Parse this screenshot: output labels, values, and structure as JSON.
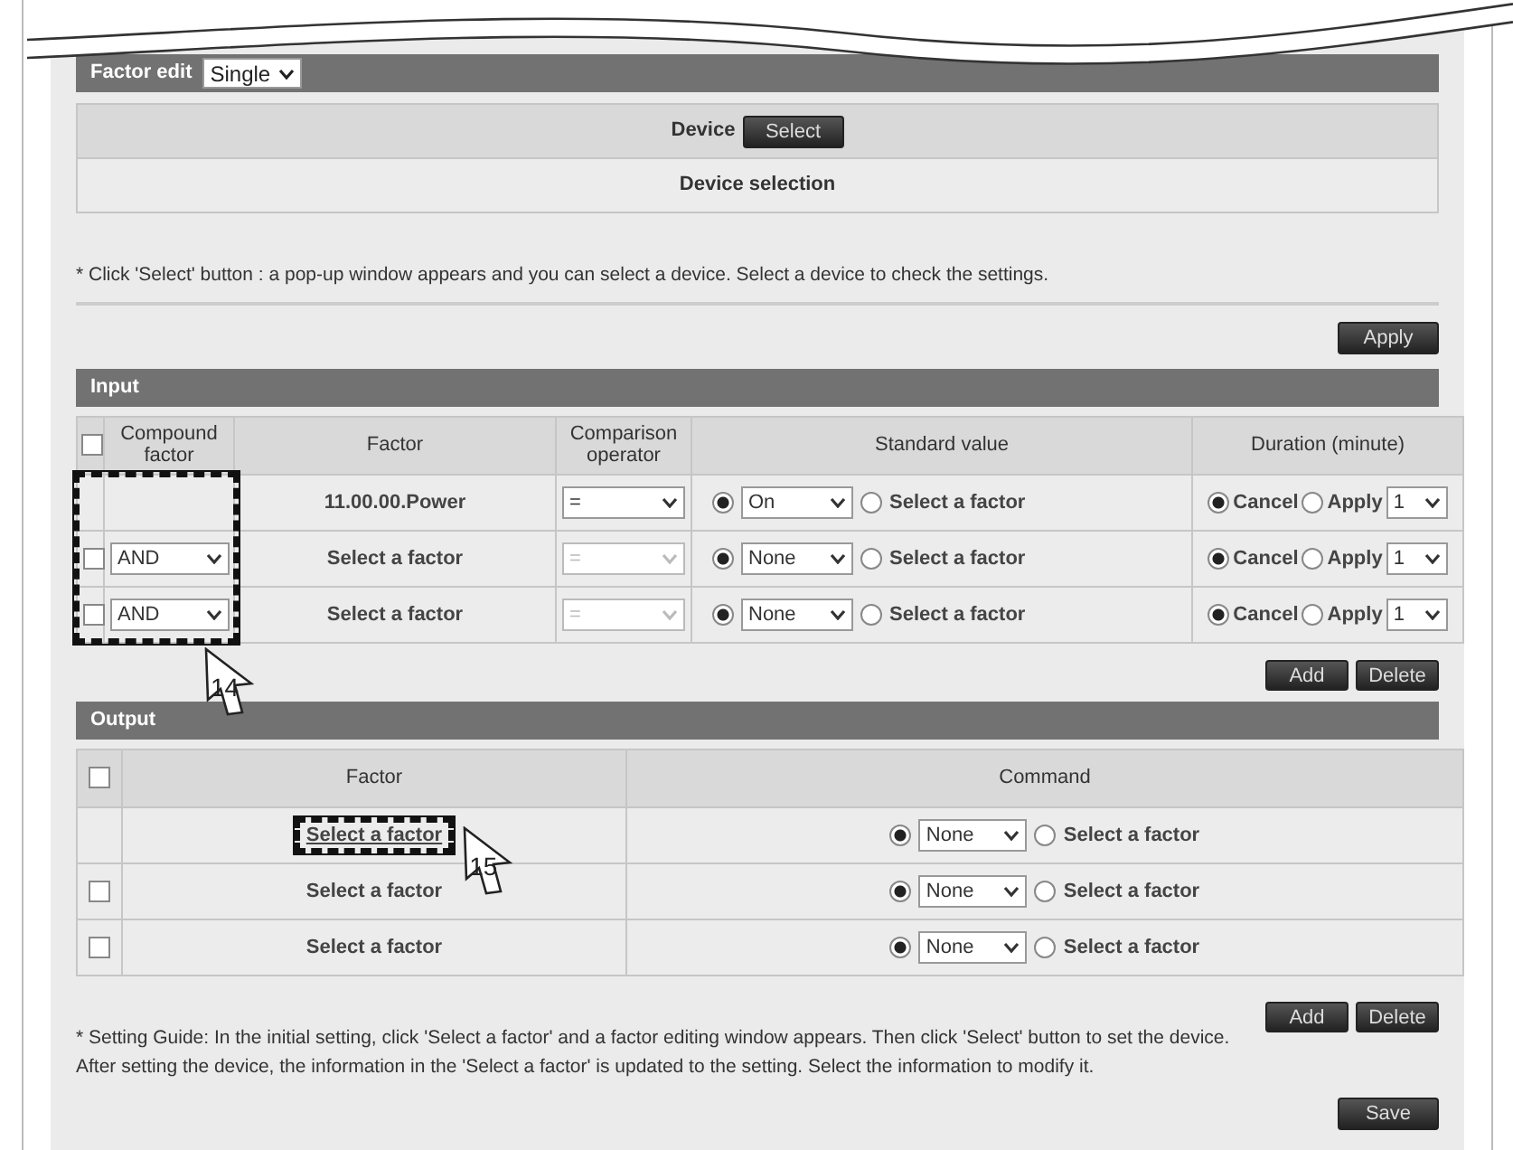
{
  "factor_edit": {
    "label": "Factor edit",
    "mode": "Single"
  },
  "device": {
    "label": "Device",
    "button": "Select",
    "selection": "Device selection"
  },
  "device_note": "* Click 'Select' button : a pop-up window appears and you can select a device. Select a device to check the settings.",
  "apply_button": "Apply",
  "input": {
    "title": "Input",
    "header_checked": false,
    "columns": [
      "Compound factor",
      "Factor",
      "Comparison operator",
      "Standard value",
      "Duration (minute)"
    ],
    "rows": [
      {
        "factor": "11.00.00.Power",
        "operator": "=",
        "operator_disabled": false,
        "list_selected": true,
        "value": "On",
        "factor_option": "Select a factor",
        "cancel_selected": true,
        "cancel_label": "Cancel",
        "apply_label": "Apply",
        "minutes": "1"
      },
      {
        "checked": false,
        "compound": "AND",
        "factor": "Select a factor",
        "operator": "=",
        "operator_disabled": true,
        "list_selected": true,
        "value": "None",
        "factor_option": "Select a factor",
        "cancel_selected": true,
        "cancel_label": "Cancel",
        "apply_label": "Apply",
        "minutes": "1"
      },
      {
        "checked": false,
        "compound": "AND",
        "factor": "Select a factor",
        "operator": "=",
        "operator_disabled": true,
        "list_selected": true,
        "value": "None",
        "factor_option": "Select a factor",
        "cancel_selected": true,
        "cancel_label": "Cancel",
        "apply_label": "Apply",
        "minutes": "1"
      }
    ],
    "callout": "14",
    "buttons": [
      "Add",
      "Delete"
    ]
  },
  "output": {
    "title": "Output",
    "header_checked": false,
    "columns": [
      "Factor",
      "Command"
    ],
    "rows": [
      {
        "factor": "Select a factor",
        "link": true,
        "list_selected": true,
        "command": "None",
        "factor_option": "Select a factor"
      },
      {
        "checked": false,
        "factor": "Select a factor",
        "link": false,
        "list_selected": true,
        "command": "None",
        "factor_option": "Select a factor"
      },
      {
        "checked": false,
        "factor": "Select a factor",
        "link": false,
        "list_selected": true,
        "command": "None",
        "factor_option": "Select a factor"
      }
    ],
    "callout": "15",
    "buttons": [
      "Add",
      "Delete"
    ]
  },
  "setting_guide": [
    "* Setting Guide: In the initial setting, click 'Select a factor' and a factor editing window appears. Then click 'Select' button to set the device.",
    "After setting the device, the information in the 'Select a factor' is updated to the setting. Select the information to modify it."
  ],
  "save_button": "Save"
}
